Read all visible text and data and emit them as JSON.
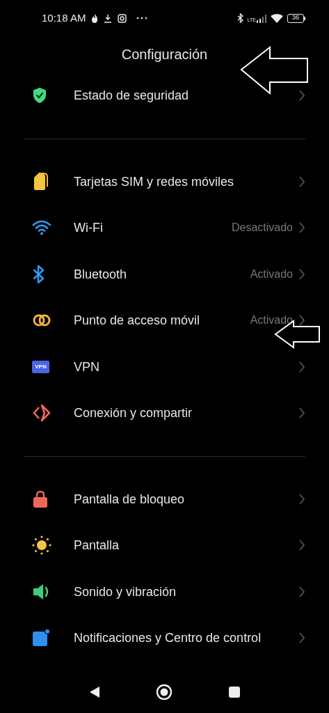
{
  "status_bar": {
    "time": "10:18 AM",
    "network": "LTE",
    "battery": "36"
  },
  "title": "Configuración",
  "sections": [
    [
      {
        "label": "Estado de seguridad",
        "kind": "shield"
      }
    ],
    [
      {
        "label": "Tarjetas SIM y redes móviles",
        "kind": "sim"
      },
      {
        "label": "Wi-Fi",
        "kind": "wifi",
        "value": "Desactivado"
      },
      {
        "label": "Bluetooth",
        "kind": "bluetooth",
        "value": "Activado"
      },
      {
        "label": "Punto de acceso móvil",
        "kind": "hotspot",
        "value": "Activado"
      },
      {
        "label": "VPN",
        "kind": "vpn",
        "badge": "VPN"
      },
      {
        "label": "Conexión y compartir",
        "kind": "share"
      }
    ],
    [
      {
        "label": "Pantalla de bloqueo",
        "kind": "lock"
      },
      {
        "label": "Pantalla",
        "kind": "sun"
      },
      {
        "label": "Sonido y vibración",
        "kind": "sound"
      },
      {
        "label": "Notificaciones y Centro de control",
        "kind": "notify"
      }
    ]
  ]
}
